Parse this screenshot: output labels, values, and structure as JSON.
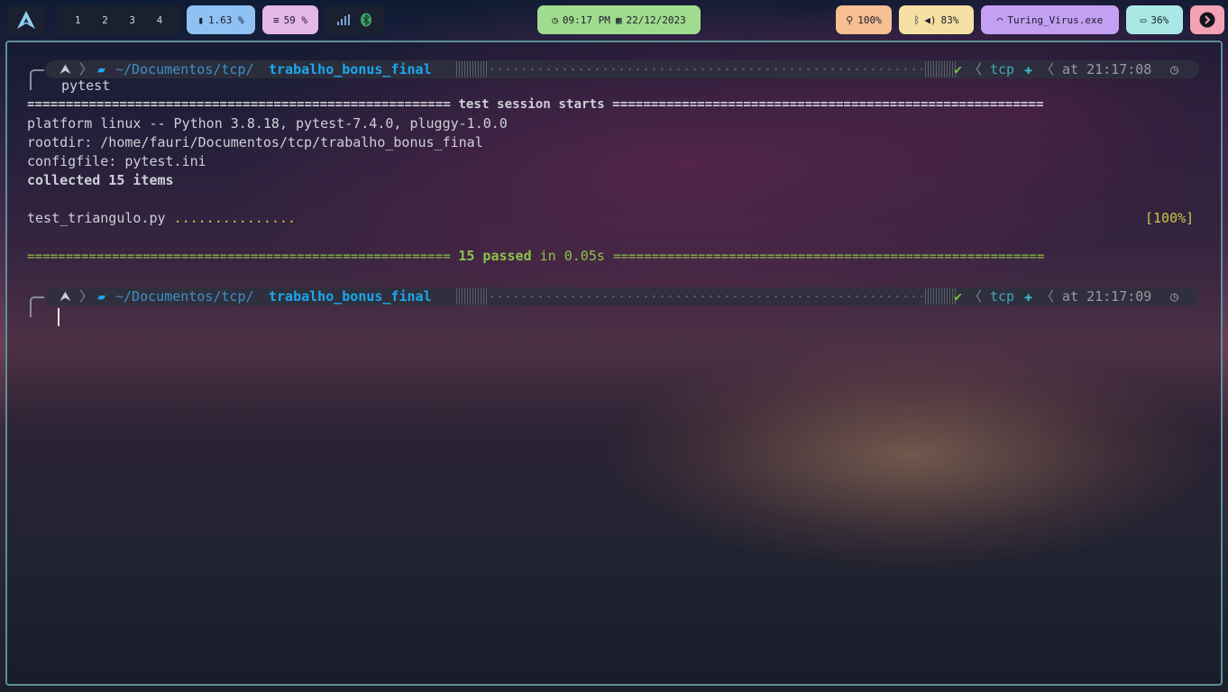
{
  "topbar": {
    "workspaces": [
      "1",
      "2",
      "3",
      "4"
    ],
    "cpu": "1.63 %",
    "memory": "59 %",
    "clock": {
      "time": "09:17 PM",
      "date": "22/12/2023"
    },
    "brightness": "100%",
    "volume": "83%",
    "wifi": "Turing_Virus.exe",
    "battery": "36%",
    "colors": {
      "cpu": "#8fc2f2",
      "memory": "#e5b6e8",
      "clock": "#9fdc8e",
      "brightness": "#f5bf92",
      "volume": "#f6dfa3",
      "wifi": "#c4a0f2",
      "battery": "#a9e8e4",
      "power": "#f3a1b5"
    }
  },
  "terminal": {
    "prompt1": {
      "path_dim": "~/Documentos/tcp/",
      "path_bold": "trabalho_bonus_final",
      "env": "tcp",
      "time": "at 21:17:08"
    },
    "command": "pytest",
    "session_header": "======================================================= test session starts ========================================================",
    "platform": "platform linux -- Python 3.8.18, pytest-7.4.0, pluggy-1.0.0",
    "rootdir": "rootdir: /home/fauri/Documentos/tcp/trabalho_bonus_final",
    "configfile": "configfile: pytest.ini",
    "collected": "collected 15 items",
    "test_file": "test_triangulo.py ",
    "test_dots": "...............",
    "test_percent": "[100%]",
    "result_eq_left": "======================================================= ",
    "result_passed": "15 passed",
    "result_time": " in 0.05s ",
    "result_eq_right": "========================================================",
    "prompt2": {
      "path_dim": "~/Documentos/tcp/",
      "path_bold": "trabalho_bonus_final",
      "env": "tcp",
      "time": "at 21:17:09"
    }
  }
}
